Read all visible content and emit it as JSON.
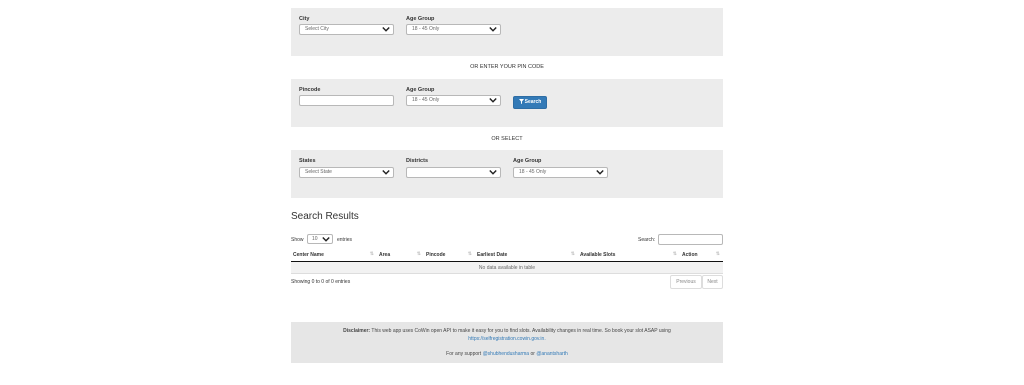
{
  "city_panel": {
    "city_label": "City",
    "city_placeholder": "Select City",
    "age_label": "Age Group",
    "age_value": "18 - 45 Only"
  },
  "sep1": "OR ENTER YOUR PIN CODE",
  "pin_panel": {
    "pin_label": "Pincode",
    "pin_value": "",
    "age_label": "Age Group",
    "age_value": "18 - 45 Only",
    "search_label": "Search"
  },
  "sep2": "OR SELECT",
  "state_panel": {
    "states_label": "States",
    "states_placeholder": "Select State",
    "districts_label": "Districts",
    "districts_value": "",
    "age_label": "Age Group",
    "age_value": "18 - 45 Only"
  },
  "results": {
    "title": "Search Results",
    "show_label": "Show",
    "entries_value": "10",
    "entries_label": "entries",
    "search_label": "Search:",
    "columns": [
      "Center Name",
      "Area",
      "Pincode",
      "Earliest Date",
      "Available Slots",
      "Action"
    ],
    "empty_message": "No data available in table",
    "info": "Showing 0 to 0 of 0 entries",
    "previous_label": "Previous",
    "next_label": "Next"
  },
  "footer": {
    "disclaimer_label": "Disclaimer:",
    "disclaimer_text": "This web app uses CoWin open API to make it easy for you to find slots. Availability changes in real time. So book your slot ASAP using",
    "link": "https://selfregistration.cowin.gov.in.",
    "support_prefix": "For any support",
    "handle1": "@shubhendusharma",
    "or_text": "or",
    "handle2": "@anantsharth"
  },
  "icons": {
    "chevron": "chevron-down-icon",
    "filter": "filter-icon"
  },
  "colors": {
    "panel": "#ececec",
    "primary": "#337ab7",
    "footer": "#e6e6e6"
  }
}
